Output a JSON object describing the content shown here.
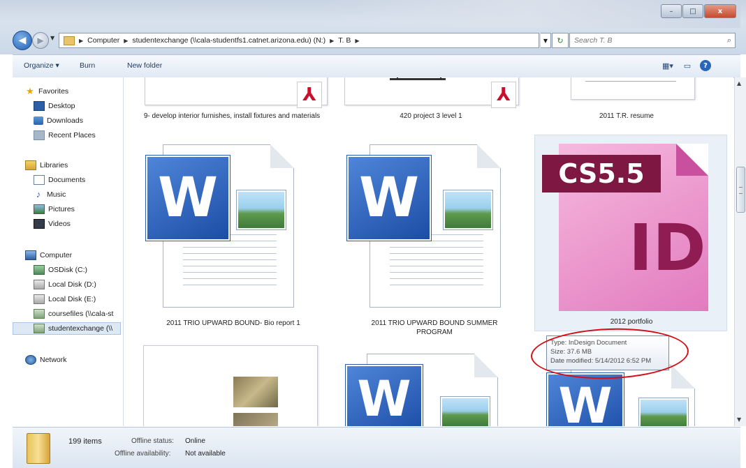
{
  "window": {
    "minimize_label": "–",
    "maximize_label": "□",
    "close_label": "x"
  },
  "nav": {
    "breadcrumbs": [
      "Computer",
      "studentexchange (\\\\cala-studentfs1.catnet.arizona.edu) (N:)",
      "T. B"
    ],
    "search_placeholder": "Search T. B"
  },
  "toolbar": {
    "organize_label": "Organize ▾",
    "burn_label": "Burn",
    "new_folder_label": "New folder"
  },
  "sidebar": {
    "favorites": {
      "label": "Favorites",
      "items": [
        "Desktop",
        "Downloads",
        "Recent Places"
      ]
    },
    "libraries": {
      "label": "Libraries",
      "items": [
        "Documents",
        "Music",
        "Pictures",
        "Videos"
      ]
    },
    "computer": {
      "label": "Computer",
      "items": [
        "OSDisk (C:)",
        "Local Disk (D:)",
        "Local Disk (E:)",
        "coursefiles (\\\\cala-st",
        "studentexchange (\\\\"
      ]
    },
    "network": {
      "label": "Network"
    }
  },
  "files": [
    {
      "name": "9- develop interior furnishes, install fixtures and materials",
      "type": "pdf"
    },
    {
      "name": "420 project 3 level 1",
      "type": "pdf"
    },
    {
      "name": "2011 T.R. resume",
      "type": "doc"
    },
    {
      "name": "2011 TRIO UPWARD BOUND- Bio report 1",
      "type": "word"
    },
    {
      "name": "2011 TRIO UPWARD BOUND SUMMER PROGRAM",
      "type": "word"
    },
    {
      "name": "2012 portfolio",
      "type": "indesign",
      "selected": true
    },
    {
      "name": "",
      "type": "image-doc"
    },
    {
      "name": "",
      "type": "word"
    },
    {
      "name": "",
      "type": "word"
    }
  ],
  "indesign_icon": {
    "badge": "CS5.5",
    "text": "ID"
  },
  "word_icon_letter": "W",
  "tooltip": {
    "type": "Type: InDesign Document",
    "size": "Size: 37.6 MB",
    "date": "Date modified: 5/14/2012 6:52 PM"
  },
  "status": {
    "item_count": "199 items",
    "offline_status_label": "Offline status:",
    "offline_status_value": "Online",
    "offline_availability_label": "Offline availability:",
    "offline_availability_value": "Not available"
  },
  "colors": {
    "annotation": "#d60d16",
    "accent": "#1f5fb4"
  }
}
